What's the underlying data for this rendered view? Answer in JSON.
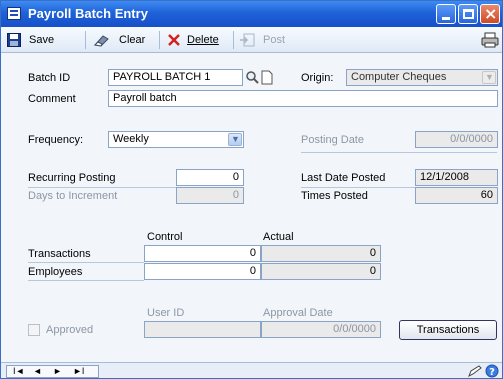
{
  "window": {
    "title": "Payroll Batch Entry",
    "icon": "form-window-icon"
  },
  "toolbar": {
    "save": "Save",
    "clear": "Clear",
    "delete": "Delete",
    "post": "Post"
  },
  "form": {
    "batch_id_label": "Batch ID",
    "batch_id_value": "PAYROLL BATCH 1",
    "origin_label": "Origin:",
    "origin_value": "Computer Cheques",
    "comment_label": "Comment",
    "comment_value": "Payroll batch",
    "frequency_label": "Frequency:",
    "frequency_value": "Weekly",
    "posting_date_label": "Posting Date",
    "posting_date_value": "0/0/0000",
    "recurring_posting_label": "Recurring Posting",
    "recurring_posting_value": "0",
    "days_to_increment_label": "Days to Increment",
    "days_to_increment_value": "0",
    "last_date_posted_label": "Last Date Posted",
    "last_date_posted_value": "12/1/2008",
    "times_posted_label": "Times Posted",
    "times_posted_value": "60"
  },
  "totals": {
    "control_header": "Control",
    "actual_header": "Actual",
    "rows": [
      {
        "label": "Transactions",
        "control": "0",
        "actual": "0"
      },
      {
        "label": "Employees",
        "control": "0",
        "actual": "0"
      }
    ]
  },
  "approval": {
    "approved_label": "Approved",
    "user_id_label": "User ID",
    "user_id_value": "",
    "approval_date_label": "Approval Date",
    "approval_date_value": "0/0/0000",
    "transactions_button": "Transactions"
  },
  "bottombar": {
    "nav_first": "I◄",
    "nav_prev": "◄",
    "nav_next": "►",
    "nav_last": "►I"
  },
  "colors": {
    "titlebar": "#1f62d8",
    "accent": "#3d8bf3",
    "delete_x": "#d42020"
  }
}
